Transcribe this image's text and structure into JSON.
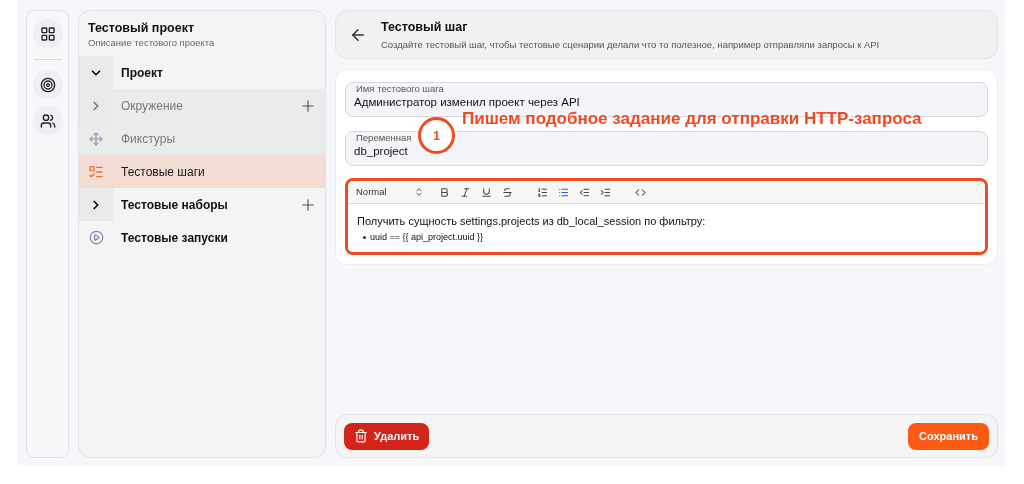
{
  "rail": [
    {
      "selected": false
    },
    {
      "selected": false
    },
    {
      "selected": false
    }
  ],
  "project": {
    "title": "Тестовый проект",
    "description": "Описание тестового проекта"
  },
  "tree": [
    {
      "kind": "group",
      "label": "Проект",
      "expanded": true,
      "addable": false,
      "children": [
        {
          "kind": "group",
          "label": "Окружение",
          "expanded": false,
          "addable": true,
          "disabled": true,
          "selected": false
        },
        {
          "kind": "fixtures",
          "label": "Фикстуры",
          "addable": false,
          "disabled": true,
          "selected": false
        },
        {
          "kind": "steps",
          "label": "Тестовые шаги",
          "addable": false,
          "disabled": false,
          "selected": true
        }
      ]
    },
    {
      "kind": "group",
      "label": "Тестовые наборы",
      "expanded": false,
      "addable": true
    },
    {
      "kind": "runs",
      "label": "Тестовые запуски",
      "addable": false
    }
  ],
  "header": {
    "title": "Тестовый шаг",
    "subtitle": "Создайте тестовый шаг, чтобы тестовые сценарии делали что то полезное, например отправляли запросы к API"
  },
  "fields": [
    {
      "label": "Имя тестового шага",
      "value": "Администратор изменил проект через API"
    },
    {
      "label": "Переменная",
      "value": "db_project"
    }
  ],
  "annotation": {
    "number": "1",
    "text": "Пишем подобное задание для отправки HTTP-запроса"
  },
  "editor": {
    "highlighted": true,
    "format": "Normal",
    "toolbar": [
      {
        "kind": "bold",
        "selected": false
      },
      {
        "kind": "italic",
        "selected": false
      },
      {
        "kind": "underline",
        "selected": false
      },
      {
        "kind": "strike",
        "selected": false
      },
      {
        "kind": "ordered",
        "selected": false
      },
      {
        "kind": "bullet",
        "selected": true
      },
      {
        "kind": "outdent",
        "selected": false
      },
      {
        "kind": "indent",
        "selected": false
      },
      {
        "kind": "code",
        "selected": false
      }
    ],
    "paragraph": "Получить сущность settings.projects из db_local_session по фильтру:",
    "bullets": [
      "uuid == {{ api_project.uuid }}"
    ]
  },
  "buttons": {
    "delete": "Удалить",
    "save": "Сохранить"
  }
}
